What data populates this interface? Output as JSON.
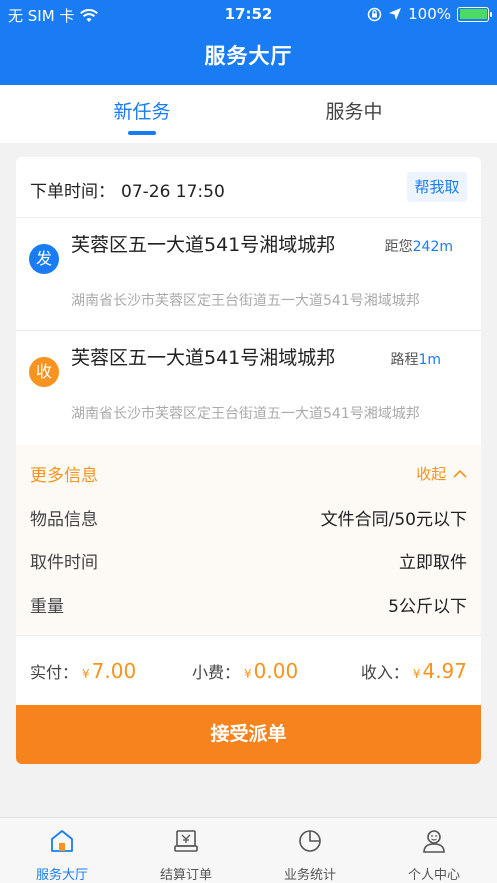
{
  "status_bar": {
    "carrier": "无 SIM 卡",
    "time": "17:52",
    "battery": "100%",
    "battery_level": 1.0
  },
  "header": {
    "title": "服务大厅"
  },
  "tabs": [
    {
      "label": "新任务",
      "active": true
    },
    {
      "label": "服务中",
      "active": false
    }
  ],
  "order": {
    "time_label": "下单时间：",
    "time_value": "07-26 17:50",
    "help_button": "帮我取",
    "sender": {
      "badge": "发",
      "address": "芙蓉区五一大道541号湘域城邦",
      "detail": "湖南省长沙市芙蓉区定王台街道五一大道541号湘域城邦",
      "distance_label": "距您",
      "distance_value": "242m"
    },
    "receiver": {
      "badge": "收",
      "address": "芙蓉区五一大道541号湘域城邦",
      "detail": "湖南省长沙市芙蓉区定王台街道五一大道541号湘域城邦",
      "distance_label": "路程",
      "distance_value": "1m"
    },
    "more_info": {
      "title": "更多信息",
      "collapse_label": "收起",
      "rows": [
        {
          "label": "物品信息",
          "value": "文件合同/50元以下"
        },
        {
          "label": "取件时间",
          "value": "立即取件"
        },
        {
          "label": "重量",
          "value": "5公斤以下"
        }
      ]
    },
    "payment": {
      "currency": "¥",
      "paid_label": "实付：",
      "paid_value": "7.00",
      "tip_label": "小费：",
      "tip_value": "0.00",
      "income_label": "收入：",
      "income_value": "4.97"
    },
    "accept_button": "接受派单"
  },
  "tabbar": [
    {
      "label": "服务大厅",
      "icon": "home-icon",
      "active": true
    },
    {
      "label": "结算订单",
      "icon": "receipt-icon",
      "active": false
    },
    {
      "label": "业务统计",
      "icon": "pie-chart-icon",
      "active": false
    },
    {
      "label": "个人中心",
      "icon": "user-icon",
      "active": false
    }
  ],
  "colors": {
    "primary": "#1a7cf2",
    "accent": "#f7931e",
    "accept_button": "#f7831e"
  }
}
